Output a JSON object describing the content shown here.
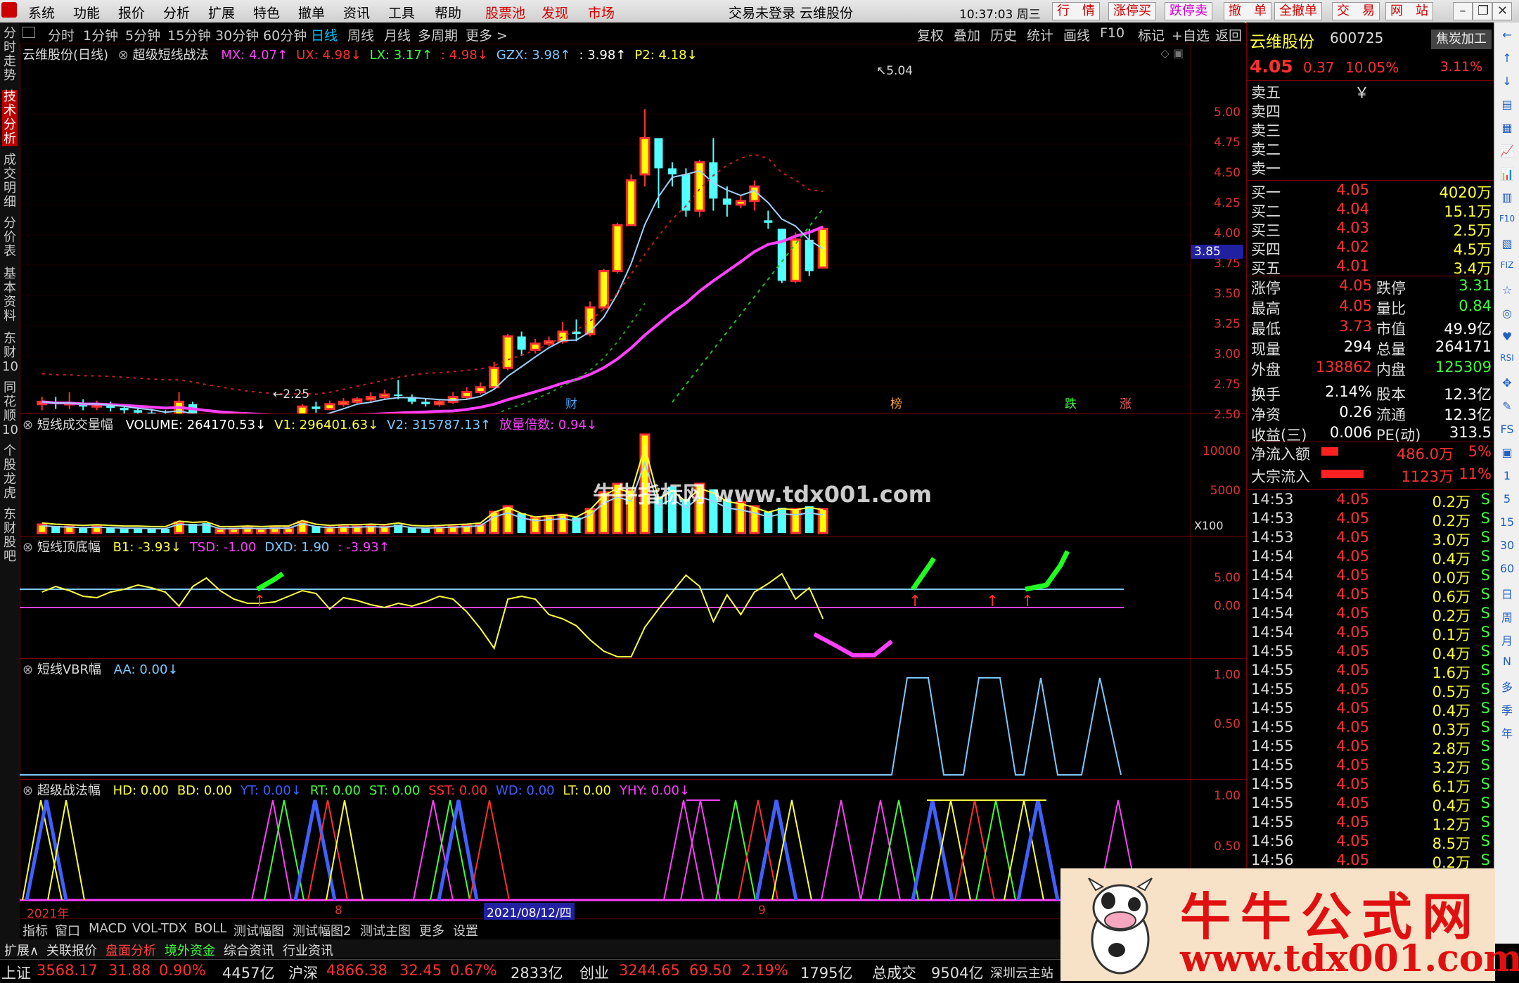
{
  "menu": {
    "items": [
      "系统",
      "功能",
      "报价",
      "分析",
      "扩展",
      "特色",
      "撤单",
      "资讯",
      "工具",
      "帮助"
    ],
    "red_items": [
      "股票池",
      "发现",
      "市场"
    ],
    "status": "交易未登录  云维股份",
    "time": "10:37:03 周三",
    "right_buttons": [
      "行　情",
      "涨停买",
      "跌停卖",
      "撤　单",
      "全撤单",
      "交　易",
      "网　站"
    ]
  },
  "periods": [
    "分时",
    "1分钟",
    "5分钟",
    "15分钟",
    "30分钟",
    "60分钟",
    "日线",
    "周线",
    "月线",
    "多周期",
    "更多 >"
  ],
  "active_period": "日线",
  "tools": [
    "复权",
    "叠加",
    "历史",
    "统计",
    "画线",
    "F10",
    "标记",
    "+自选",
    "返回"
  ],
  "left_tabs": [
    "分时走势",
    "技术分析",
    "成交明细",
    "分价表",
    "基本资料",
    "东财10",
    "同花顺10",
    "个股龙虎",
    "东财股吧"
  ],
  "main_chart": {
    "title": "云维股份(日线)",
    "indicator": "超级短线战法",
    "values": [
      {
        "t": "MX: 4.07↑",
        "c": "#ff40ff"
      },
      {
        "t": "UX: 4.98↓",
        "c": "#ff3030"
      },
      {
        "t": "LX: 3.17↑",
        "c": "#40ff40"
      },
      {
        "t": ": 4.98↓",
        "c": "#ff3030"
      },
      {
        "t": "GZX: 3.98↑",
        "c": "#7ec8ff"
      },
      {
        "t": ": 3.98↑",
        "c": "#ffffff"
      },
      {
        "t": "P2: 4.18↓",
        "c": "#ffff40"
      }
    ],
    "high_label": "5.04",
    "low_label": "2.25",
    "current_price_tag": "3.85",
    "ticks": [
      "5.00",
      "4.75",
      "4.50",
      "4.25",
      "4.00",
      "3.75",
      "3.50",
      "3.25",
      "3.00",
      "2.75",
      "2.50"
    ],
    "markers": [
      {
        "t": "财",
        "c": "#4da6ff"
      },
      {
        "t": "榜",
        "c": "#ffa040"
      },
      {
        "t": "跌",
        "c": "#40ff40"
      },
      {
        "t": "涨",
        "c": "#ff6060"
      }
    ]
  },
  "volume_pane": {
    "title": "短线成交量幅",
    "values": [
      {
        "t": "VOLUME: 264170.53↓",
        "c": "#ffffff"
      },
      {
        "t": "V1: 296401.63↓",
        "c": "#ffff40"
      },
      {
        "t": "V2: 315787.13↑",
        "c": "#7ec8ff"
      },
      {
        "t": "放量倍数: 0.94↓",
        "c": "#ff40ff"
      }
    ],
    "ticks": [
      "10000",
      "5000"
    ],
    "unit": "X100",
    "watermark": "牛牛指标网 www.tdx001.com"
  },
  "topbottom_pane": {
    "title": "短线顶底幅",
    "values": [
      {
        "t": "B1: -3.93↓",
        "c": "#ffff40"
      },
      {
        "t": "TSD: -1.00",
        "c": "#ff40ff"
      },
      {
        "t": "DXD: 1.90",
        "c": "#7ec8ff"
      },
      {
        "t": ": -3.93↑",
        "c": "#ff40ff"
      }
    ],
    "ticks": [
      "5.00",
      "0.00"
    ]
  },
  "vbr_pane": {
    "title": "短线VBR幅",
    "values": [
      {
        "t": "AA: 0.00↓",
        "c": "#7ec8ff"
      }
    ],
    "ticks": [
      "1.00",
      "0.50"
    ]
  },
  "strategy_pane": {
    "title": "超级战法幅",
    "values": [
      {
        "t": "HD: 0.00",
        "c": "#ffff40"
      },
      {
        "t": "BD: 0.00",
        "c": "#ffff40"
      },
      {
        "t": "YT: 0.00↓",
        "c": "#4060ff"
      },
      {
        "t": "RT: 0.00",
        "c": "#40ff40"
      },
      {
        "t": "ST: 0.00",
        "c": "#40ff40"
      },
      {
        "t": "SST: 0.00",
        "c": "#ff3030"
      },
      {
        "t": "WD: 0.00",
        "c": "#4060ff"
      },
      {
        "t": "LT: 0.00",
        "c": "#ffff40"
      },
      {
        "t": "YHY: 0.00↓",
        "c": "#ff40ff"
      }
    ],
    "ticks": [
      "1.00",
      "0.50"
    ],
    "date_labels": [
      "2021年",
      "8",
      "2021/08/12/四",
      "9"
    ]
  },
  "quote": {
    "name": "云维股份",
    "code": "600725",
    "sector_btn": "焦炭加工",
    "price": "4.05",
    "change": "0.37",
    "pct": "10.05%",
    "sector_pct": "3.11%",
    "sell": [
      {
        "lbl": "卖五",
        "p": "￥",
        "v": ""
      },
      {
        "lbl": "卖四",
        "p": "",
        "v": ""
      },
      {
        "lbl": "卖三",
        "p": "",
        "v": ""
      },
      {
        "lbl": "卖二",
        "p": "",
        "v": ""
      },
      {
        "lbl": "卖一",
        "p": "",
        "v": ""
      }
    ],
    "buy": [
      {
        "lbl": "买一",
        "p": "4.05",
        "v": "4020万"
      },
      {
        "lbl": "买二",
        "p": "4.04",
        "v": "15.1万"
      },
      {
        "lbl": "买三",
        "p": "4.03",
        "v": "2.5万"
      },
      {
        "lbl": "买四",
        "p": "4.02",
        "v": "4.5万"
      },
      {
        "lbl": "买五",
        "p": "4.01",
        "v": "3.4万"
      }
    ],
    "stats": [
      {
        "l1": "涨停",
        "v1": "4.05",
        "c1": "#ff3030",
        "l2": "跌停",
        "v2": "3.31",
        "c2": "#40ff40"
      },
      {
        "l1": "最高",
        "v1": "4.05",
        "c1": "#ff3030",
        "l2": "量比",
        "v2": "0.84",
        "c2": "#40ff40"
      },
      {
        "l1": "最低",
        "v1": "3.73",
        "c1": "#ff3030",
        "l2": "市值",
        "v2": "49.9亿",
        "c2": "#ffffff"
      },
      {
        "l1": "现量",
        "v1": "294",
        "c1": "#ffffff",
        "l2": "总量",
        "v2": "264171",
        "c2": "#ffffff"
      },
      {
        "l1": "外盘",
        "v1": "138862",
        "c1": "#ff3030",
        "l2": "内盘",
        "v2": "125309",
        "c2": "#40ff40"
      },
      {
        "l1": "换手",
        "v1": "2.14%",
        "c1": "#ffffff",
        "l2": "股本",
        "v2": "12.3亿",
        "c2": "#ffffff"
      },
      {
        "l1": "净资",
        "v1": "0.26",
        "c1": "#ffffff",
        "l2": "流通",
        "v2": "12.3亿",
        "c2": "#ffffff"
      },
      {
        "l1": "收益(三)",
        "v1": "0.006",
        "c1": "#ffffff",
        "l2": "PE(动)",
        "v2": "313.5",
        "c2": "#ffffff"
      }
    ],
    "flows": [
      {
        "lbl": "净流入额",
        "val": "486.0万",
        "pct": "5%",
        "ratio": 0.3
      },
      {
        "lbl": "大宗流入",
        "val": "1123万",
        "pct": "11%",
        "ratio": 0.75
      }
    ],
    "ticks": [
      {
        "t": "14:53",
        "p": "4.05",
        "v": "0.2万"
      },
      {
        "t": "14:53",
        "p": "4.05",
        "v": "0.2万"
      },
      {
        "t": "14:53",
        "p": "4.05",
        "v": "3.0万"
      },
      {
        "t": "14:54",
        "p": "4.05",
        "v": "0.4万"
      },
      {
        "t": "14:54",
        "p": "4.05",
        "v": "0.0万"
      },
      {
        "t": "14:54",
        "p": "4.05",
        "v": "0.6万"
      },
      {
        "t": "14:54",
        "p": "4.05",
        "v": "0.2万"
      },
      {
        "t": "14:54",
        "p": "4.05",
        "v": "0.1万"
      },
      {
        "t": "14:55",
        "p": "4.05",
        "v": "0.4万"
      },
      {
        "t": "14:55",
        "p": "4.05",
        "v": "1.6万"
      },
      {
        "t": "14:55",
        "p": "4.05",
        "v": "0.5万"
      },
      {
        "t": "14:55",
        "p": "4.05",
        "v": "0.4万"
      },
      {
        "t": "14:55",
        "p": "4.05",
        "v": "0.3万"
      },
      {
        "t": "14:55",
        "p": "4.05",
        "v": "2.8万"
      },
      {
        "t": "14:55",
        "p": "4.05",
        "v": "3.2万"
      },
      {
        "t": "14:55",
        "p": "4.05",
        "v": "6.1万"
      },
      {
        "t": "14:55",
        "p": "4.05",
        "v": "0.4万"
      },
      {
        "t": "14:55",
        "p": "4.05",
        "v": "1.2万"
      },
      {
        "t": "14:56",
        "p": "4.05",
        "v": "8.5万"
      },
      {
        "t": "14:56",
        "p": "4.05",
        "v": "0.2万"
      }
    ],
    "tick_flag": "S"
  },
  "right_icons": [
    "←",
    "↑",
    "↓",
    "▤",
    "▦",
    "📈",
    "📊",
    "▥",
    "F10",
    "▧",
    "FIZ",
    "☆",
    "◎",
    "♥",
    "RSI",
    "✥",
    "✎",
    "FS",
    "▣",
    "1",
    "5",
    "15",
    "30",
    "60",
    "日",
    "周",
    "月",
    "N",
    "多",
    "季",
    "年"
  ],
  "bottom_tabs": [
    "指标",
    "窗口",
    "MACD",
    "VOL-TDX",
    "BOLL",
    "测试幅图",
    "测试幅图2",
    "测试主图",
    "更多",
    "设置"
  ],
  "sub_tabs": [
    "扩展∧",
    "关联报价",
    "盘面分析",
    "境外资金",
    "综合资讯",
    "行业资讯"
  ],
  "status": {
    "sh_lbl": "上证",
    "sh_val": "3568.17",
    "sh_chg": "31.88",
    "sh_pct": "0.90%",
    "sh_amt": "4457亿",
    "sz_lbl": "沪深",
    "sz_val": "4866.38",
    "sz_chg": "32.45",
    "sz_pct": "0.67%",
    "sz_amt": "2833亿",
    "cy_lbl": "创业",
    "cy_val": "3244.65",
    "cy_chg": "69.50",
    "cy_pct": "2.19%",
    "cy_amt": "1795亿",
    "total_lbl": "总成交",
    "total_val": "9504亿",
    "site": "深圳云主站"
  },
  "promo": {
    "title": "牛牛公式网",
    "url": "www.tdx001.com"
  }
}
